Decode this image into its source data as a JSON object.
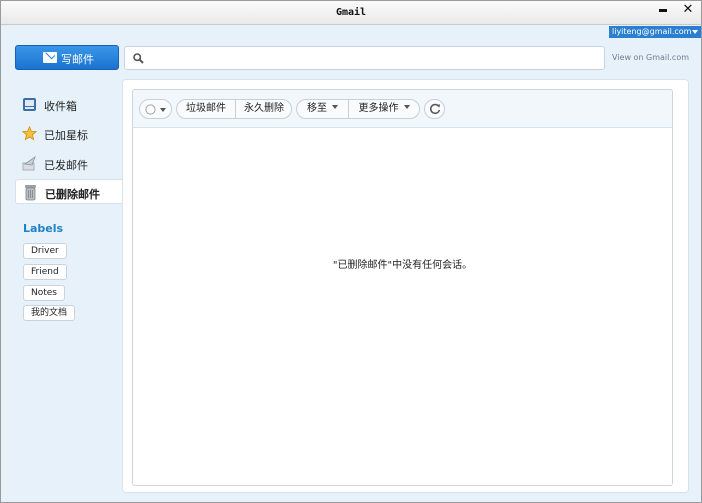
{
  "window": {
    "title": "Gmail"
  },
  "account": {
    "email": "liyiteng@gmail.com"
  },
  "compose": {
    "label": "写邮件"
  },
  "search": {
    "value": "",
    "placeholder": ""
  },
  "view_on": "View on Gmail.com",
  "nav": {
    "items": [
      {
        "label": "收件箱",
        "icon": "inbox-icon"
      },
      {
        "label": "已加星标",
        "icon": "star-icon"
      },
      {
        "label": "已发邮件",
        "icon": "sent-icon"
      },
      {
        "label": "已删除邮件",
        "icon": "trash-icon",
        "active": true
      }
    ]
  },
  "labels": {
    "title": "Labels",
    "items": [
      "Driver",
      "Friend",
      "Notes",
      "我的文档"
    ]
  },
  "toolbar": {
    "spam": "垃圾邮件",
    "delete_forever": "永久删除",
    "move_to": "移至",
    "more_actions": "更多操作"
  },
  "empty_message": "\"已删除邮件\"中没有任何会话。",
  "colors": {
    "accent": "#1a73cf",
    "label_title": "#1f82c5",
    "background": "#e7f1fa"
  }
}
